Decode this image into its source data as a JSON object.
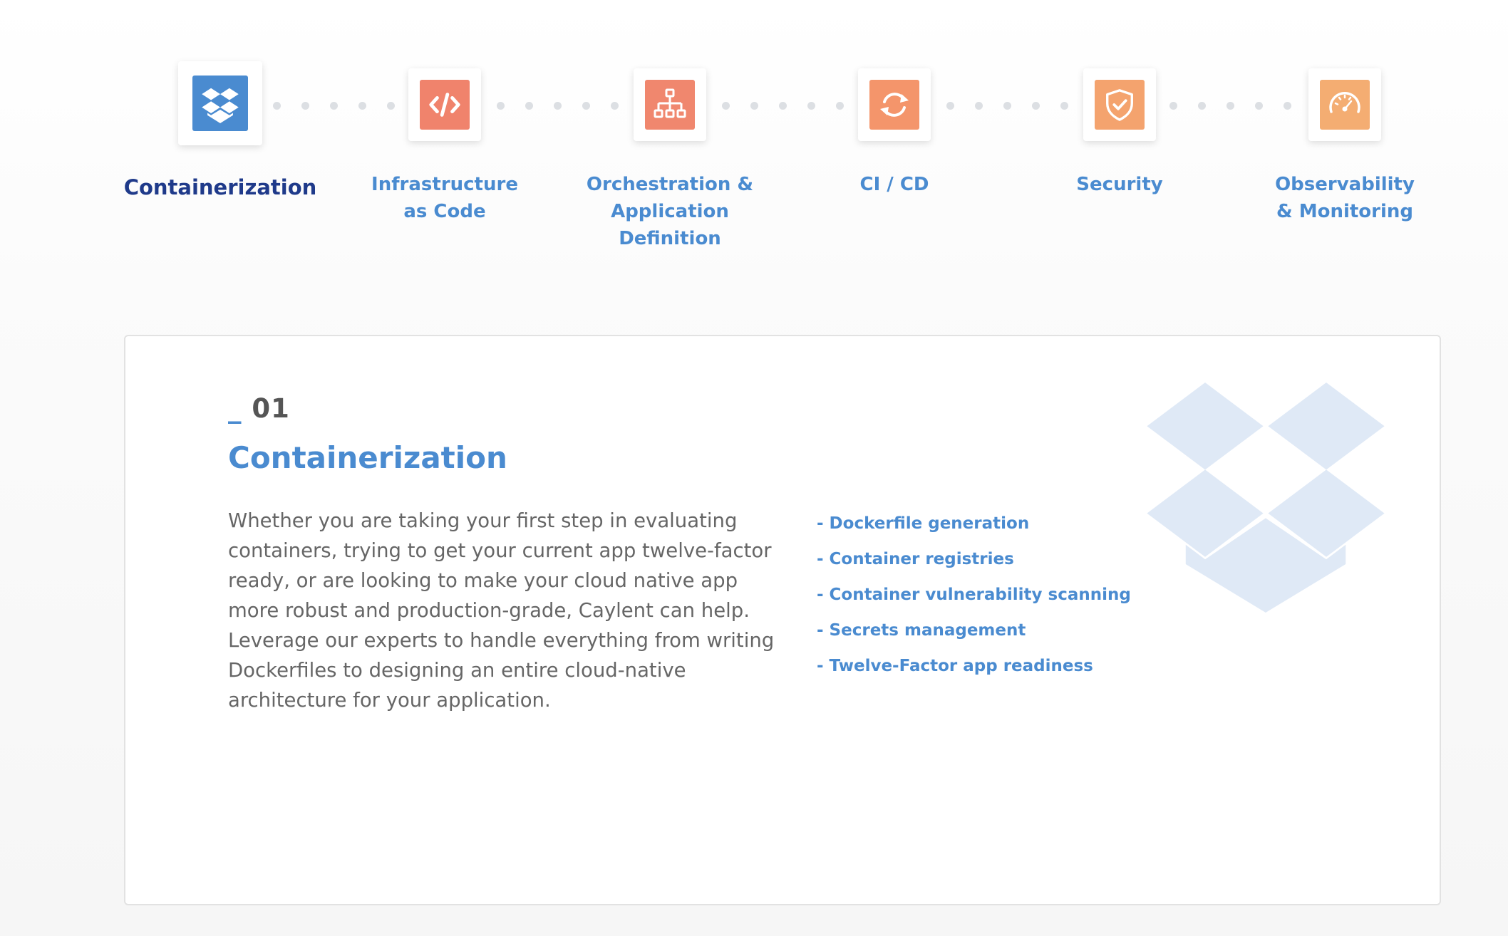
{
  "steps": [
    {
      "label_lines": [
        "Containerization"
      ],
      "icon": "box-icon",
      "tile_color": "#4a8bd0",
      "active": true
    },
    {
      "label_lines": [
        "Infrastructure",
        "as Code"
      ],
      "icon": "code-icon",
      "tile_color": "#f0836c",
      "active": false
    },
    {
      "label_lines": [
        "Orchestration &",
        "Application",
        "Definition"
      ],
      "icon": "sitemap-icon",
      "tile_color": "#f0876e",
      "active": false
    },
    {
      "label_lines": [
        "CI / CD"
      ],
      "icon": "sync-icon",
      "tile_color": "#f4956b",
      "active": false
    },
    {
      "label_lines": [
        "Security"
      ],
      "icon": "shield-check-icon",
      "tile_color": "#f4a36e",
      "active": false
    },
    {
      "label_lines": [
        "Observability",
        "& Monitoring"
      ],
      "icon": "gauge-icon",
      "tile_color": "#f4ad72",
      "active": false
    }
  ],
  "panel": {
    "number_prefix": "_",
    "number": "01",
    "title": "Containerization",
    "description": "Whether you are taking your first step in evaluating containers, trying to get your current app twelve-factor ready, or are looking to make your cloud native app more robust and production-grade, Caylent can help. Leverage our experts to handle everything from writing Dockerfiles to designing an entire cloud-native architecture for your application.",
    "features": [
      "- Dockerfile generation",
      "- Container registries",
      "- Container vulnerability scanning",
      "- Secrets management",
      "- Twelve-Factor app readiness"
    ],
    "watermark_icon": "box-icon",
    "watermark_color": "#dfe9f6"
  },
  "colors": {
    "accent_blue": "#4a8bd0",
    "active_label": "#1f3a8a",
    "dot": "#dcdfe3"
  }
}
